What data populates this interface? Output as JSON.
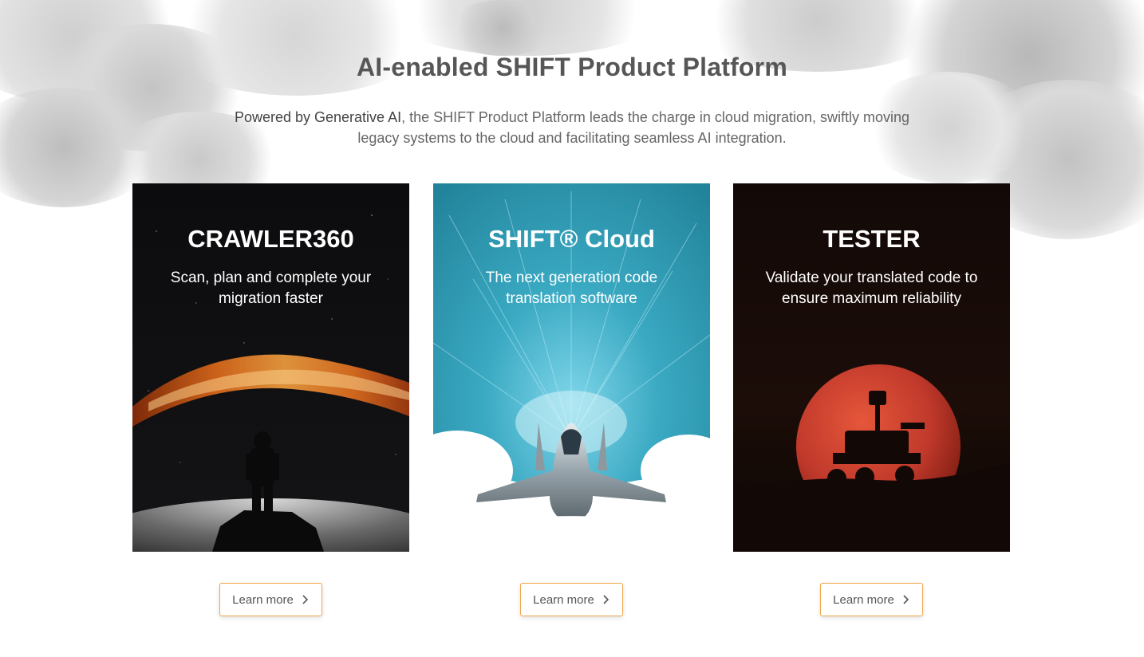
{
  "heading": "AI-enabled SHIFT Product Platform",
  "subtitle": {
    "strong": "Powered by Generative AI",
    "rest": ", the SHIFT Product Platform leads the charge in cloud migration, swiftly moving legacy systems to the cloud and facilitating seamless AI integration."
  },
  "cards": [
    {
      "title": "CRAWLER360",
      "description": "Scan, plan and complete your migration faster",
      "button": "Learn more",
      "image": "astronaut-galaxy-image"
    },
    {
      "title": "SHIFT® Cloud",
      "description": "The next generation code translation software",
      "button": "Learn more",
      "image": "fighter-jet-clouds-image"
    },
    {
      "title": "TESTER",
      "description": "Validate your translated code to ensure maximum reliability",
      "button": "Learn more",
      "image": "rover-red-planet-image"
    }
  ],
  "icons": {
    "button_arrow": "chevron-right-icon"
  },
  "colors": {
    "button_border": "#f0a64a",
    "heading": "#565656",
    "card2_bg": "#2f9fb7",
    "card3_planet": "#c0392b"
  }
}
